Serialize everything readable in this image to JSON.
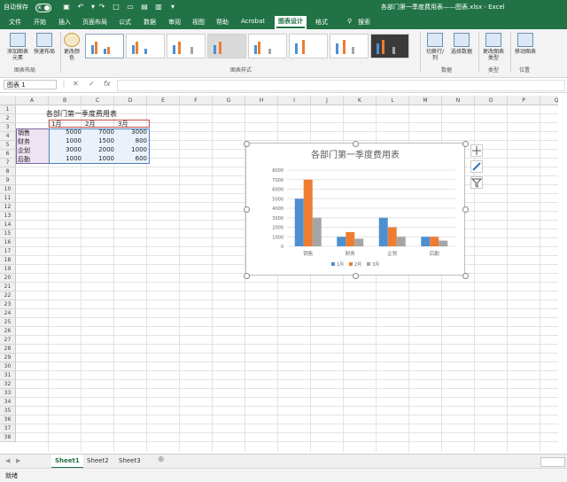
{
  "titlebar": {
    "autosave_label": "自动保存",
    "autosave_state": "关",
    "doc_title": "各部门第一季度费用表——图表.xlsx  -  Excel"
  },
  "tabs": [
    "文件",
    "开始",
    "插入",
    "页面布局",
    "公式",
    "数据",
    "审阅",
    "视图",
    "帮助",
    "Acrobat",
    "图表设计",
    "格式"
  ],
  "active_tab": "图表设计",
  "search_label": "搜索",
  "ribbon": {
    "add_element": "添加图表元素",
    "quick_layout": "快速布局",
    "change_color": "更改颜色",
    "group_layout": "图表布局",
    "group_styles": "图表样式",
    "switch_row_col": "切换行/列",
    "select_data": "选择数据",
    "group_data": "数据",
    "change_type": "更改图表类型",
    "group_type": "类型",
    "move_chart": "移动图表",
    "group_location": "位置"
  },
  "formula_bar": {
    "name_box": "图表 1",
    "fx": "fx",
    "formula": ""
  },
  "columns": [
    "A",
    "B",
    "C",
    "D",
    "E",
    "F",
    "G",
    "H",
    "I",
    "J",
    "K",
    "L",
    "M",
    "N",
    "O",
    "P",
    "Q"
  ],
  "rows": [
    "1",
    "2",
    "3",
    "4",
    "5",
    "6",
    "7",
    "8",
    "9",
    "10",
    "11",
    "12",
    "13",
    "14",
    "15",
    "16",
    "17",
    "18",
    "19",
    "20",
    "21",
    "22",
    "23",
    "24",
    "25",
    "26",
    "27",
    "28",
    "29",
    "30",
    "31",
    "32",
    "33",
    "34",
    "35",
    "36",
    "37",
    "38"
  ],
  "table": {
    "title": "各部门第一季度费用表",
    "headers": [
      "1月",
      "2月",
      "3月"
    ],
    "rows": [
      {
        "dept": "销售",
        "v": [
          "5000",
          "7000",
          "3000"
        ]
      },
      {
        "dept": "财务",
        "v": [
          "1000",
          "1500",
          "800"
        ]
      },
      {
        "dept": "企划",
        "v": [
          "3000",
          "2000",
          "1000"
        ]
      },
      {
        "dept": "后勤",
        "v": [
          "1000",
          "1000",
          "600"
        ]
      }
    ]
  },
  "chart_data": {
    "type": "bar",
    "title": "各部门第一季度费用表",
    "categories": [
      "销售",
      "财务",
      "企划",
      "后勤"
    ],
    "series": [
      {
        "name": "1月",
        "values": [
          5000,
          1000,
          3000,
          1000
        ],
        "color": "#4e8fd2"
      },
      {
        "name": "2月",
        "values": [
          7000,
          1500,
          2000,
          1000
        ],
        "color": "#ed7d31"
      },
      {
        "name": "3月",
        "values": [
          3000,
          800,
          1000,
          600
        ],
        "color": "#a5a5a5"
      }
    ],
    "yticks": [
      "0",
      "1000",
      "2000",
      "3000",
      "4000",
      "5000",
      "6000",
      "7000",
      "8000"
    ],
    "ylim": [
      0,
      8000
    ],
    "legend": "bottom",
    "grid": true
  },
  "sheets": [
    "Sheet1",
    "Sheet2",
    "Sheet3"
  ],
  "active_sheet": "Sheet1",
  "status": "就绪",
  "colors": {
    "excel_green": "#217346"
  }
}
